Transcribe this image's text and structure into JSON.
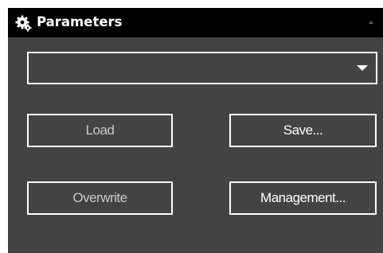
{
  "panel": {
    "title": "Parameters",
    "title_icon": "gears-icon",
    "collapse_icon": "chevron-up-icon"
  },
  "parameter_select": {
    "value": "",
    "icon": "chevron-down-icon"
  },
  "buttons": {
    "load": "Load",
    "save": "Save...",
    "overwrite": "Overwrite",
    "management": "Management..."
  },
  "colors": {
    "panel_bg": "#434343",
    "titlebar_bg": "#000000",
    "text": "#ffffff",
    "disabled_text": "#c8c8c8"
  }
}
